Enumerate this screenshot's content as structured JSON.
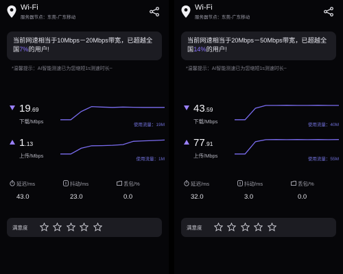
{
  "panels": [
    {
      "wifi_title": "Wi-Fi",
      "server_label": "服务器节点：东莞-广东移动",
      "banner_before": "当前网速相当于10Mbps－20Mbps带宽，已超越全国",
      "banner_pct": "7%",
      "banner_after": "的用户!",
      "tip": "*温馨提示：AI智能测速已为您缩短1s测速时长~",
      "download": {
        "int": "19",
        "dec": ".69",
        "label": "下载/Mbps",
        "traffic": "使用流量：19M",
        "trace": [
          0.05,
          0.05,
          0.55,
          0.85,
          0.82,
          0.8,
          0.82,
          0.81,
          0.8,
          0.8,
          0.8
        ]
      },
      "upload": {
        "int": "1",
        "dec": ".13",
        "label": "上传/Mbps",
        "traffic": "使用流量：1M",
        "trace": [
          0.05,
          0.05,
          0.4,
          0.55,
          0.56,
          0.58,
          0.62,
          0.82,
          0.85,
          0.87,
          0.9
        ]
      },
      "latency": {
        "label": "延迟/ms",
        "value": "43.0"
      },
      "jitter": {
        "label": "抖动/ms",
        "value": "23.0"
      },
      "loss": {
        "label": "丢包/%",
        "value": "0.0"
      },
      "rating_label": "满意度",
      "rating_value": 0
    },
    {
      "wifi_title": "Wi-Fi",
      "server_label": "服务器节点：东莞-广东移动",
      "banner_before": "当前网速相当于20Mbps－50Mbps带宽，已超越全国",
      "banner_pct": "14%",
      "banner_after": "的用户!",
      "tip": "*温馨提示：AI智能测速已为您缩短1s测速时长~",
      "download": {
        "int": "43",
        "dec": ".59",
        "label": "下载/Mbps",
        "traffic": "使用流量：40M",
        "trace": [
          0.05,
          0.05,
          0.75,
          0.92,
          0.92,
          0.93,
          0.92,
          0.92,
          0.93,
          0.92,
          0.92
        ]
      },
      "upload": {
        "int": "77",
        "dec": ".91",
        "label": "上传/Mbps",
        "traffic": "使用流量：55M",
        "trace": [
          0.05,
          0.05,
          0.8,
          0.92,
          0.93,
          0.92,
          0.93,
          0.92,
          0.93,
          0.92,
          0.93
        ]
      },
      "latency": {
        "label": "延迟/ms",
        "value": "32.0"
      },
      "jitter": {
        "label": "抖动/ms",
        "value": "3.0"
      },
      "loss": {
        "label": "丢包/%",
        "value": "0.0"
      },
      "rating_label": "满意度",
      "rating_value": 0
    }
  ],
  "colors": {
    "accent": "#8a73ff",
    "graph_line": "#7a6cf0",
    "card_bg": "#1c1c22"
  }
}
